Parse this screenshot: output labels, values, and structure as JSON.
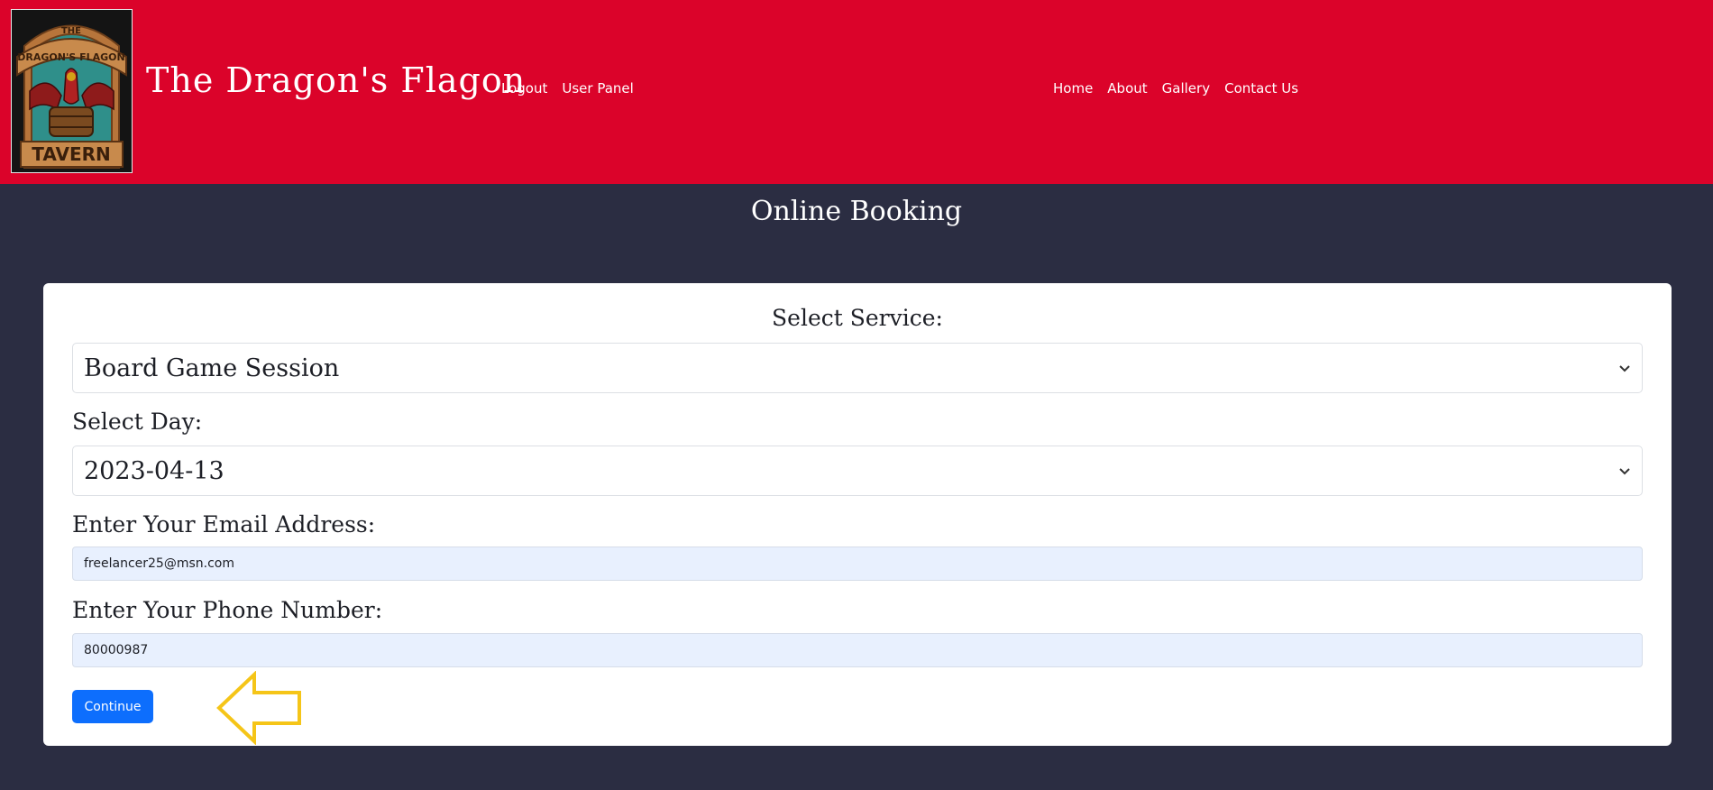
{
  "header": {
    "logo": {
      "text_top": "THE",
      "text_mid": "DRAGON'S FLAGON",
      "text_bottom": "TAVERN"
    },
    "title": "The Dragon's Flagon",
    "nav_left": [
      "Logout",
      "User Panel"
    ],
    "nav_right": [
      "Home",
      "About",
      "Gallery",
      "Contact Us"
    ]
  },
  "page": {
    "heading": "Online Booking"
  },
  "form": {
    "service_label": "Select Service:",
    "service_value": "Board Game Session",
    "day_label": "Select Day:",
    "day_value": "2023-04-13",
    "email_label": "Enter Your Email Address:",
    "email_value": "freelancer25@msn.com",
    "phone_label": "Enter Your Phone Number:",
    "phone_value": "80000987",
    "continue_label": "Continue"
  },
  "colors": {
    "header_bg": "#db032a",
    "page_bg": "#2b2d42",
    "button": "#0d6efd",
    "input_autofill": "#e8f0fe",
    "annotation_arrow": "#f5c518"
  },
  "icons": {
    "select_chevron": "chevron-down-icon",
    "annotation": "arrow-left-icon"
  }
}
